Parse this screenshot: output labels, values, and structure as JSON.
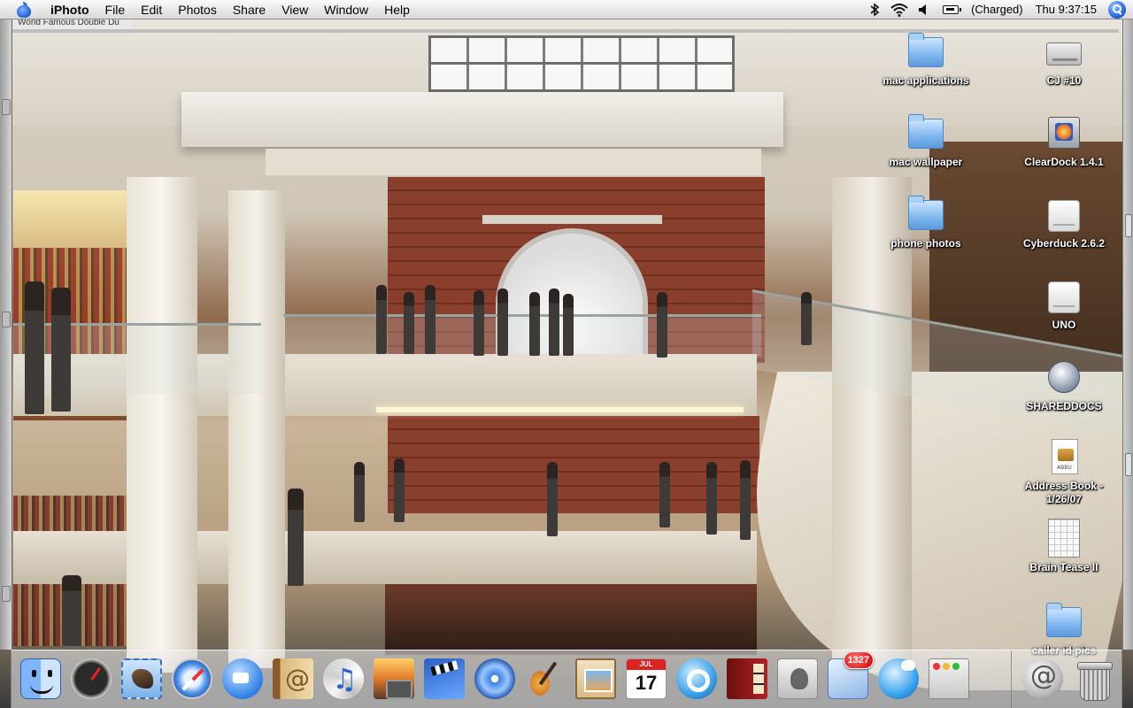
{
  "menubar": {
    "app_name": "iPhoto",
    "menus": [
      "File",
      "Edit",
      "Photos",
      "Share",
      "View",
      "Window",
      "Help"
    ],
    "battery_status": "(Charged)",
    "clock": "Thu 9:37:15",
    "status_icons": [
      "bluetooth-icon",
      "wifi-icon",
      "volume-icon",
      "battery-icon",
      "spotlight-icon"
    ]
  },
  "background_window": {
    "title_fragment": "World Famous Double Du"
  },
  "desktop": {
    "icons": [
      {
        "label": "mac applications",
        "type": "folder"
      },
      {
        "label": "CJ #10",
        "type": "hard-drive"
      },
      {
        "label": "mac wallpaper",
        "type": "folder"
      },
      {
        "label": "ClearDock 1.4.1",
        "type": "application"
      },
      {
        "label": "phone photos",
        "type": "folder"
      },
      {
        "label": "Cyberduck 2.6.2",
        "type": "disk-image"
      },
      {
        "label": "UNO",
        "type": "external-drive"
      },
      {
        "label": "SHAREDDOCS",
        "type": "network-share"
      },
      {
        "label": "Address Book - 1/26/07",
        "type": "document",
        "doc_tag": "ABBU"
      },
      {
        "label": "Brain Tease II",
        "type": "document"
      },
      {
        "label": "caller id pics",
        "type": "folder"
      }
    ]
  },
  "dock": {
    "apps": [
      {
        "name": "Finder",
        "icon": "finder-icon",
        "running": true
      },
      {
        "name": "Dashboard",
        "icon": "dashboard-icon",
        "running": true
      },
      {
        "name": "Mail",
        "icon": "mail-icon",
        "running": false
      },
      {
        "name": "Safari",
        "icon": "safari-icon",
        "running": true
      },
      {
        "name": "iChat",
        "icon": "ichat-icon",
        "running": true
      },
      {
        "name": "Address Book",
        "icon": "address-book-icon",
        "running": false
      },
      {
        "name": "iTunes",
        "icon": "itunes-icon",
        "running": false
      },
      {
        "name": "iPhoto",
        "icon": "iphoto-icon",
        "running": true
      },
      {
        "name": "iMovie",
        "icon": "imovie-icon",
        "running": false
      },
      {
        "name": "iDVD",
        "icon": "idvd-icon",
        "running": false
      },
      {
        "name": "GarageBand",
        "icon": "garageband-icon",
        "running": false
      },
      {
        "name": "iWeb",
        "icon": "iweb-icon",
        "running": false
      },
      {
        "name": "iCal",
        "icon": "ical-icon",
        "running": false,
        "month": "JUL",
        "day": "17"
      },
      {
        "name": "QuickTime Player",
        "icon": "quicktime-icon",
        "running": false
      },
      {
        "name": "Photo Booth",
        "icon": "photo-booth-icon",
        "running": false
      },
      {
        "name": "System Preferences",
        "icon": "system-preferences-icon",
        "running": false
      },
      {
        "name": "Mail Counter",
        "icon": "mail-badge-icon",
        "running": true,
        "badge": "1327"
      },
      {
        "name": "Network Browser",
        "icon": "globe-icon",
        "running": true
      },
      {
        "name": "Window Manager",
        "icon": "window-icon",
        "running": true
      }
    ],
    "right": [
      {
        "name": "Address Widget",
        "icon": "at-sign-icon",
        "running": false
      },
      {
        "name": "Trash",
        "icon": "trash-icon",
        "running": false
      }
    ]
  }
}
